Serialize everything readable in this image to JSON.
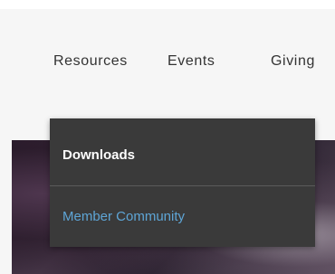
{
  "nav": {
    "items": [
      {
        "label": "Resources"
      },
      {
        "label": "Events"
      },
      {
        "label": "Giving"
      }
    ]
  },
  "dropdown": {
    "items": [
      {
        "label": "Downloads",
        "color": "#ffffff"
      },
      {
        "label": "Member Community",
        "color": "#5ea5d6"
      }
    ],
    "background": "#3a3a3a"
  }
}
